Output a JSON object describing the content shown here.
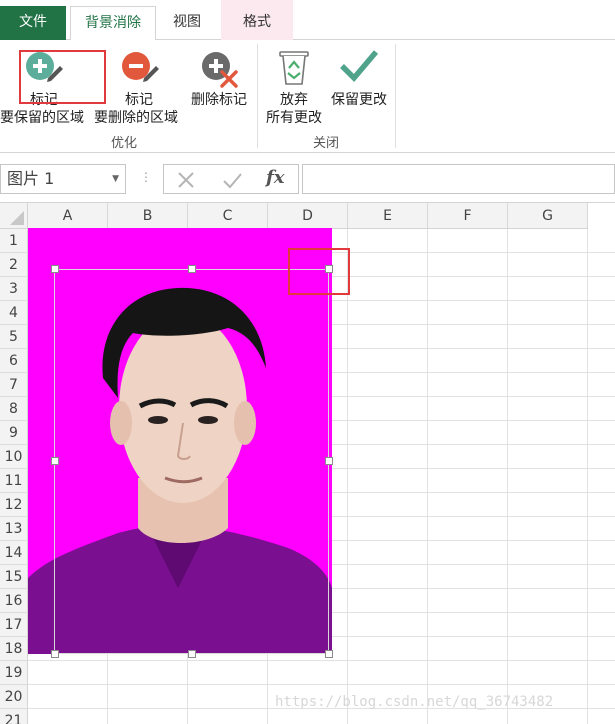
{
  "tabs": {
    "file": "文件",
    "background_removal": "背景消除",
    "view": "视图",
    "format": "格式"
  },
  "ribbon": {
    "mark_keep": {
      "line1": "标记",
      "line2": "要保留的区域"
    },
    "mark_remove": {
      "line1": "标记",
      "line2": "要删除的区域"
    },
    "delete_mark": "删除标记",
    "discard": {
      "line1": "放弃",
      "line2": "所有更改"
    },
    "keep_changes": "保留更改",
    "group_refine": "优化",
    "group_close": "关闭"
  },
  "formula_bar": {
    "name_box": "图片 1",
    "fx": "fx",
    "value": ""
  },
  "columns": [
    "A",
    "B",
    "C",
    "D",
    "E",
    "F",
    "G"
  ],
  "rows": [
    "1",
    "2",
    "3",
    "4",
    "5",
    "6",
    "7",
    "8",
    "9",
    "10",
    "11",
    "12",
    "13",
    "14",
    "15",
    "16",
    "17",
    "18",
    "19",
    "20",
    "21"
  ],
  "watermark": "https://blog.csdn.net/qq_36743482",
  "colors": {
    "accent": "#217346",
    "photo_background": "#ff00ff",
    "highlight": "#e0393e"
  }
}
